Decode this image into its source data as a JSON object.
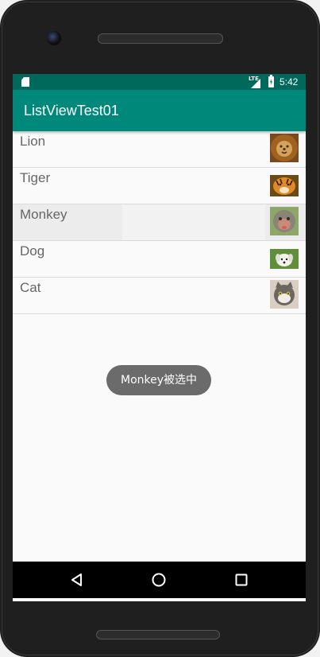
{
  "status_bar": {
    "network_label": "LTE",
    "time": "5:42",
    "icons": [
      "sd-card-icon",
      "lte-icon",
      "signal-icon",
      "battery-charging-icon"
    ]
  },
  "app_bar": {
    "title": "ListViewTest01"
  },
  "list": {
    "items": [
      {
        "label": "Lion",
        "thumbnail": "lion-image",
        "selected": false
      },
      {
        "label": "Tiger",
        "thumbnail": "tiger-image",
        "selected": false
      },
      {
        "label": "Monkey",
        "thumbnail": "monkey-image",
        "selected": true
      },
      {
        "label": "Dog",
        "thumbnail": "dog-image",
        "selected": false
      },
      {
        "label": "Cat",
        "thumbnail": "cat-image",
        "selected": false
      }
    ]
  },
  "toast": {
    "text": "Monkey被选中"
  },
  "nav_bar": {
    "buttons": [
      "back-icon",
      "home-icon",
      "recents-icon"
    ]
  },
  "colors": {
    "status_bar": "#00695c",
    "app_bar": "#00897b",
    "list_background": "#fafafa",
    "selected_row": "#ececec",
    "toast_background": "#6b6b6b"
  }
}
